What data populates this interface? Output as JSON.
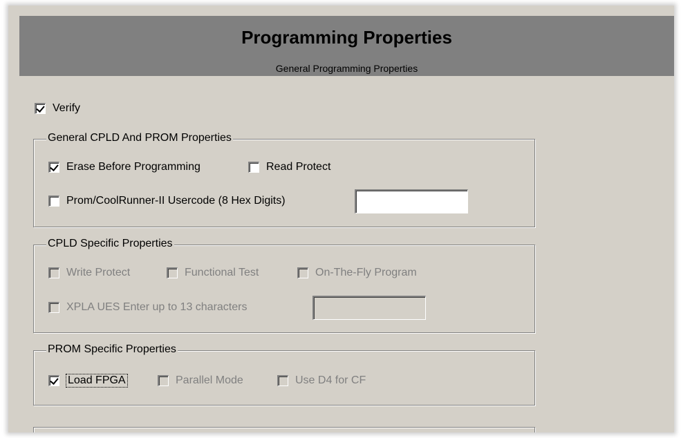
{
  "header": {
    "title": "Programming Properties",
    "subtitle": "General Programming Properties"
  },
  "verify": {
    "label": "Verify",
    "checked": true
  },
  "general_group": {
    "title": "General CPLD And PROM Properties",
    "erase_before_programming": {
      "label": "Erase Before Programming",
      "checked": true
    },
    "read_protect": {
      "label": "Read Protect",
      "checked": false
    },
    "usercode": {
      "label": "Prom/CoolRunner-II Usercode (8 Hex Digits)",
      "checked": false,
      "value": ""
    }
  },
  "cpld_group": {
    "title": "CPLD Specific Properties",
    "write_protect": {
      "label": "Write Protect",
      "checked": false
    },
    "functional_test": {
      "label": "Functional Test",
      "checked": false
    },
    "on_the_fly": {
      "label": "On-The-Fly Program",
      "checked": false
    },
    "xpla_ues": {
      "label": "XPLA UES Enter up to 13 characters",
      "checked": false,
      "value": ""
    }
  },
  "prom_group": {
    "title": "PROM Specific Properties",
    "load_fpga": {
      "label": "Load FPGA",
      "checked": true
    },
    "parallel_mode": {
      "label": "Parallel Mode",
      "checked": false
    },
    "use_d4": {
      "label": "Use D4 for CF",
      "checked": false
    }
  }
}
